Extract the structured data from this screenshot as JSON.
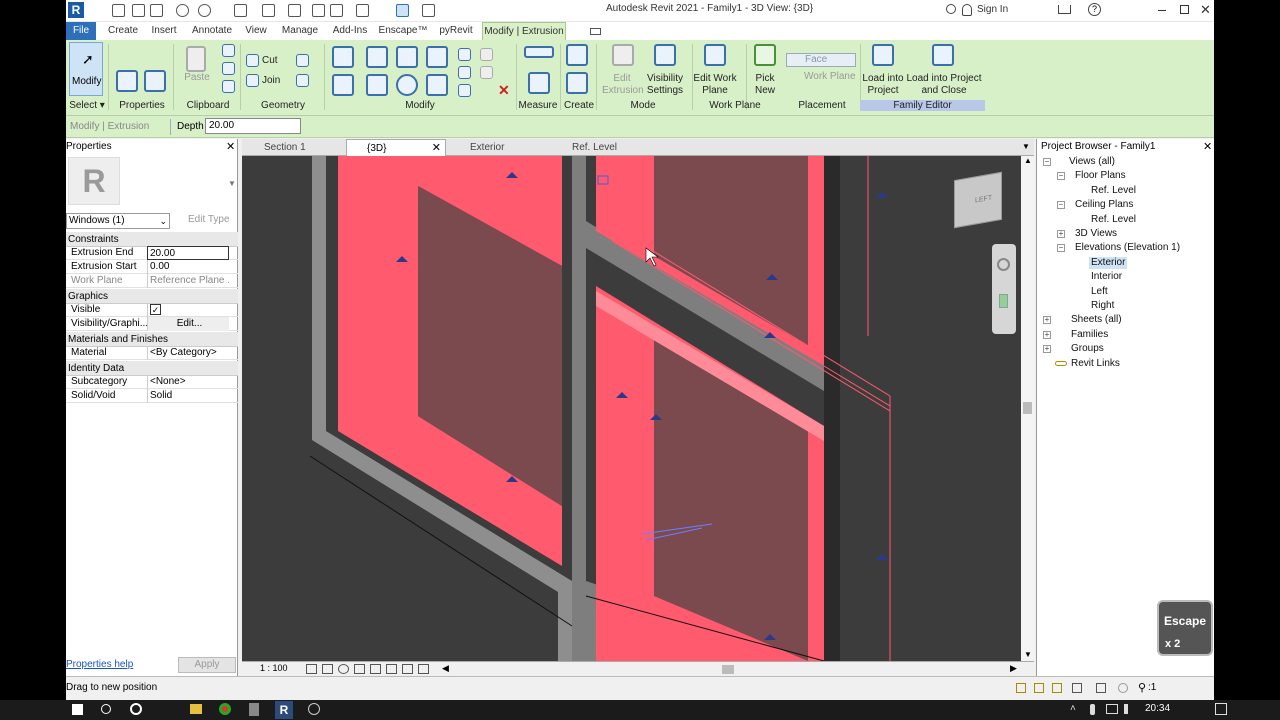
{
  "window": {
    "title": "Autodesk Revit 2021 - Family1 - 3D View: {3D}",
    "sign_in": "Sign In"
  },
  "tabs": [
    "File",
    "Create",
    "Insert",
    "Annotate",
    "View",
    "Manage",
    "Add-Ins",
    "Enscape™",
    "pyRevit",
    "Modify | Extrusion"
  ],
  "ribbon": {
    "modify": "Modify",
    "paste": "Paste",
    "cut": "Cut",
    "join": "Join",
    "edit_extrusion": "Edit Extrusion",
    "visibility_settings": "Visibility Settings",
    "edit_work_plane": "Edit Work Plane",
    "pick_new": "Pick New",
    "face": "Face",
    "work_plane": "Work Plane",
    "load_into_project": "Load into Project",
    "load_into_project_close": "Load into Project and Close",
    "panels": [
      "Select ▾",
      "Properties",
      "Clipboard",
      "Geometry",
      "Modify",
      "Measure",
      "Create",
      "Mode",
      "Work Plane",
      "Placement",
      "Family Editor"
    ]
  },
  "options_bar": {
    "context": "Modify | Extrusion",
    "depth_label": "Depth",
    "depth_value": "20.00"
  },
  "properties": {
    "title": "Properties",
    "type_selector": "Windows (1)",
    "edit_type": "Edit Type",
    "groups": {
      "constraints": "Constraints",
      "graphics": "Graphics",
      "materials": "Materials and Finishes",
      "identity": "Identity Data"
    },
    "rows": {
      "extrusion_end": {
        "k": "Extrusion End",
        "v": "20.00"
      },
      "extrusion_start": {
        "k": "Extrusion Start",
        "v": "0.00"
      },
      "work_plane": {
        "k": "Work Plane",
        "v": "Reference Plane ..."
      },
      "visible": {
        "k": "Visible",
        "v": "✓"
      },
      "visibility_graphics": {
        "k": "Visibility/Graphi...",
        "v": "Edit..."
      },
      "material": {
        "k": "Material",
        "v": "<By Category>"
      },
      "subcategory": {
        "k": "Subcategory",
        "v": "<None>"
      },
      "solid_void": {
        "k": "Solid/Void",
        "v": "Solid"
      }
    },
    "help": "Properties help",
    "apply": "Apply"
  },
  "view_tabs": [
    "Section 1",
    "{3D}",
    "Exterior",
    "Ref. Level"
  ],
  "view_scale": "1 : 100",
  "viewcube_face": "LEFT",
  "browser": {
    "title": "Project Browser - Family1",
    "nodes": [
      "Views (all)",
      "Floor Plans",
      "Ref. Level",
      "Ceiling Plans",
      "Ref. Level",
      "3D Views",
      "Elevations (Elevation 1)",
      "Exterior",
      "Interior",
      "Left",
      "Right",
      "Sheets (all)",
      "Families",
      "Groups",
      "Revit Links"
    ]
  },
  "status": {
    "text": "Drag to new position",
    "selection_count": ":1"
  },
  "escape_key": {
    "label": "Escape",
    "count": "x 2"
  },
  "taskbar": {
    "time": "20:34"
  },
  "colors": {
    "ribbon": "#d8f0c8",
    "file_tab": "#2d6fbb",
    "extrusion": "#ff5a6e"
  }
}
